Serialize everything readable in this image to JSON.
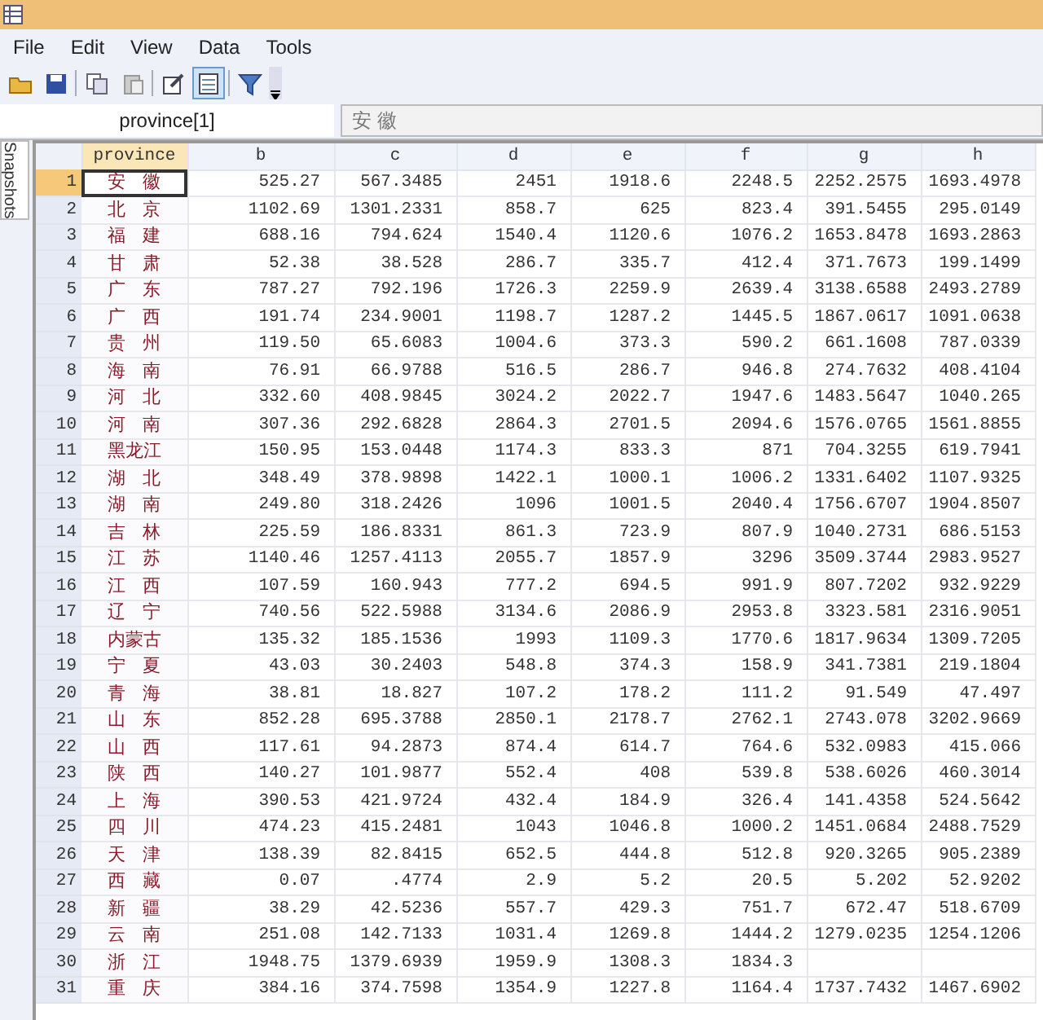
{
  "menu": [
    "File",
    "Edit",
    "View",
    "Data",
    "Tools"
  ],
  "toolbar": [
    {
      "kind": "open",
      "selected": false
    },
    {
      "kind": "save",
      "selected": false
    },
    {
      "kind": "copy",
      "selected": false
    },
    {
      "kind": "paste",
      "selected": false
    },
    {
      "kind": "edit",
      "selected": false
    },
    {
      "kind": "browse",
      "selected": true
    },
    {
      "kind": "filter",
      "selected": false
    }
  ],
  "cell_name": "province[1]",
  "cell_value": "安 徽",
  "side_tab": "Snapshots",
  "table": {
    "columns": [
      {
        "label": "province",
        "selected": true
      },
      {
        "label": "b",
        "selected": false
      },
      {
        "label": "c",
        "selected": false
      },
      {
        "label": "d",
        "selected": false
      },
      {
        "label": "e",
        "selected": false
      },
      {
        "label": "f",
        "selected": false
      },
      {
        "label": "g",
        "selected": false
      },
      {
        "label": "h",
        "selected": false
      }
    ],
    "rows": [
      {
        "number": "1",
        "selected": true,
        "cells": [
          "安 徽",
          "525.27",
          "567.3485",
          "2451",
          "1918.6",
          "2248.5",
          "2252.2575",
          "1693.4978"
        ]
      },
      {
        "number": "2",
        "selected": false,
        "cells": [
          "北 京",
          "1102.69",
          "1301.2331",
          "858.7",
          "625",
          "823.4",
          "391.5455",
          "295.0149"
        ]
      },
      {
        "number": "3",
        "selected": false,
        "cells": [
          "福 建",
          "688.16",
          "794.624",
          "1540.4",
          "1120.6",
          "1076.2",
          "1653.8478",
          "1693.2863"
        ]
      },
      {
        "number": "4",
        "selected": false,
        "cells": [
          "甘 肃",
          "52.38",
          "38.528",
          "286.7",
          "335.7",
          "412.4",
          "371.7673",
          "199.1499"
        ]
      },
      {
        "number": "5",
        "selected": false,
        "cells": [
          "广 东",
          "787.27",
          "792.196",
          "1726.3",
          "2259.9",
          "2639.4",
          "3138.6588",
          "2493.2789"
        ]
      },
      {
        "number": "6",
        "selected": false,
        "cells": [
          "广 西",
          "191.74",
          "234.9001",
          "1198.7",
          "1287.2",
          "1445.5",
          "1867.0617",
          "1091.0638"
        ]
      },
      {
        "number": "7",
        "selected": false,
        "cells": [
          "贵 州",
          "119.50",
          "65.6083",
          "1004.6",
          "373.3",
          "590.2",
          "661.1608",
          "787.0339"
        ]
      },
      {
        "number": "8",
        "selected": false,
        "cells": [
          "海 南",
          "76.91",
          "66.9788",
          "516.5",
          "286.7",
          "946.8",
          "274.7632",
          "408.4104"
        ]
      },
      {
        "number": "9",
        "selected": false,
        "cells": [
          "河 北",
          "332.60",
          "408.9845",
          "3024.2",
          "2022.7",
          "1947.6",
          "1483.5647",
          "1040.265"
        ]
      },
      {
        "number": "10",
        "selected": false,
        "cells": [
          "河 南",
          "307.36",
          "292.6828",
          "2864.3",
          "2701.5",
          "2094.6",
          "1576.0765",
          "1561.8855"
        ]
      },
      {
        "number": "11",
        "selected": false,
        "cells": [
          "黑龙江",
          "150.95",
          "153.0448",
          "1174.3",
          "833.3",
          "871",
          "704.3255",
          "619.7941"
        ]
      },
      {
        "number": "12",
        "selected": false,
        "cells": [
          "湖 北",
          "348.49",
          "378.9898",
          "1422.1",
          "1000.1",
          "1006.2",
          "1331.6402",
          "1107.9325"
        ]
      },
      {
        "number": "13",
        "selected": false,
        "cells": [
          "湖 南",
          "249.80",
          "318.2426",
          "1096",
          "1001.5",
          "2040.4",
          "1756.6707",
          "1904.8507"
        ]
      },
      {
        "number": "14",
        "selected": false,
        "cells": [
          "吉 林",
          "225.59",
          "186.8331",
          "861.3",
          "723.9",
          "807.9",
          "1040.2731",
          "686.5153"
        ]
      },
      {
        "number": "15",
        "selected": false,
        "cells": [
          "江 苏",
          "1140.46",
          "1257.4113",
          "2055.7",
          "1857.9",
          "3296",
          "3509.3744",
          "2983.9527"
        ]
      },
      {
        "number": "16",
        "selected": false,
        "cells": [
          "江 西",
          "107.59",
          "160.943",
          "777.2",
          "694.5",
          "991.9",
          "807.7202",
          "932.9229"
        ]
      },
      {
        "number": "17",
        "selected": false,
        "cells": [
          "辽 宁",
          "740.56",
          "522.5988",
          "3134.6",
          "2086.9",
          "2953.8",
          "3323.581",
          "2316.9051"
        ]
      },
      {
        "number": "18",
        "selected": false,
        "cells": [
          "内蒙古",
          "135.32",
          "185.1536",
          "1993",
          "1109.3",
          "1770.6",
          "1817.9634",
          "1309.7205"
        ]
      },
      {
        "number": "19",
        "selected": false,
        "cells": [
          "宁 夏",
          "43.03",
          "30.2403",
          "548.8",
          "374.3",
          "158.9",
          "341.7381",
          "219.1804"
        ]
      },
      {
        "number": "20",
        "selected": false,
        "cells": [
          "青 海",
          "38.81",
          "18.827",
          "107.2",
          "178.2",
          "111.2",
          "91.549",
          "47.497"
        ]
      },
      {
        "number": "21",
        "selected": false,
        "cells": [
          "山 东",
          "852.28",
          "695.3788",
          "2850.1",
          "2178.7",
          "2762.1",
          "2743.078",
          "3202.9669"
        ]
      },
      {
        "number": "22",
        "selected": false,
        "cells": [
          "山 西",
          "117.61",
          "94.2873",
          "874.4",
          "614.7",
          "764.6",
          "532.0983",
          "415.066"
        ]
      },
      {
        "number": "23",
        "selected": false,
        "cells": [
          "陕 西",
          "140.27",
          "101.9877",
          "552.4",
          "408",
          "539.8",
          "538.6026",
          "460.3014"
        ]
      },
      {
        "number": "24",
        "selected": false,
        "cells": [
          "上 海",
          "390.53",
          "421.9724",
          "432.4",
          "184.9",
          "326.4",
          "141.4358",
          "524.5642"
        ]
      },
      {
        "number": "25",
        "selected": false,
        "cells": [
          "四 川",
          "474.23",
          "415.2481",
          "1043",
          "1046.8",
          "1000.2",
          "1451.0684",
          "2488.7529"
        ]
      },
      {
        "number": "26",
        "selected": false,
        "cells": [
          "天 津",
          "138.39",
          "82.8415",
          "652.5",
          "444.8",
          "512.8",
          "920.3265",
          "905.2389"
        ]
      },
      {
        "number": "27",
        "selected": false,
        "cells": [
          "西 藏",
          "0.07",
          ".4774",
          "2.9",
          "5.2",
          "20.5",
          "5.202",
          "52.9202"
        ]
      },
      {
        "number": "28",
        "selected": false,
        "cells": [
          "新 疆",
          "38.29",
          "42.5236",
          "557.7",
          "429.3",
          "751.7",
          "672.47",
          "518.6709"
        ]
      },
      {
        "number": "29",
        "selected": false,
        "cells": [
          "云 南",
          "251.08",
          "142.7133",
          "1031.4",
          "1269.8",
          "1444.2",
          "1279.0235",
          "1254.1206"
        ]
      },
      {
        "number": "30",
        "selected": false,
        "cells": [
          "浙 江",
          "1948.75",
          "1379.6939",
          "1959.9",
          "1308.3",
          "1834.3",
          null,
          null
        ]
      },
      {
        "number": "31",
        "selected": false,
        "cells": [
          "重 庆",
          "384.16",
          "374.7598",
          "1354.9",
          "1227.8",
          "1164.4",
          "1737.7432",
          "1467.6902"
        ]
      }
    ]
  }
}
